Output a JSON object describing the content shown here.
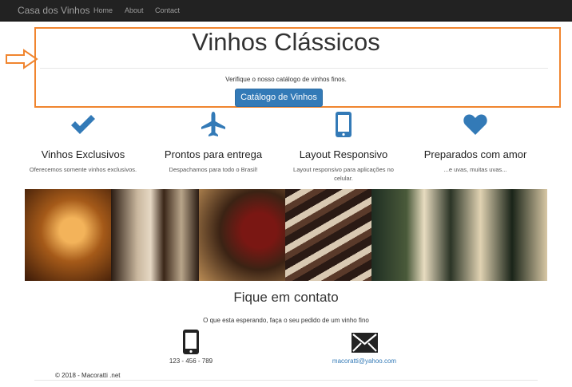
{
  "navbar": {
    "brand": "Casa dos Vinhos",
    "links": [
      "Home",
      "About",
      "Contact"
    ]
  },
  "jumbotron": {
    "title": "Vinhos Clássicos",
    "subtitle": "Verifique o nosso catálogo de vinhos finos.",
    "button": "Catálogo de Vinhos"
  },
  "features": [
    {
      "icon": "checkmark-icon",
      "title": "Vinhos Exclusivos",
      "text": "Oferecemos somente vinhos exclusivos."
    },
    {
      "icon": "airplane-icon",
      "title": "Prontos para entrega",
      "text": "Despachamos para todo o Brasil!"
    },
    {
      "icon": "mobile-phone-icon",
      "title": "Layout Responsivo",
      "text": "Layout responsivo para aplicações no celular."
    },
    {
      "icon": "heart-icon",
      "title": "Preparados com amor",
      "text": "...e uvas, muitas uvas..."
    }
  ],
  "contact": {
    "title": "Fique em contato",
    "subtitle": "O que esta esperando, faça o seu pedido de um vinho fino",
    "phone": "123 - 456 - 789",
    "email": "macoratti@yahoo.com"
  },
  "footer": "© 2018 - Macoratti .net",
  "colors": {
    "accent": "#337ab7",
    "highlight": "#f0852f",
    "navbar": "#222222"
  }
}
